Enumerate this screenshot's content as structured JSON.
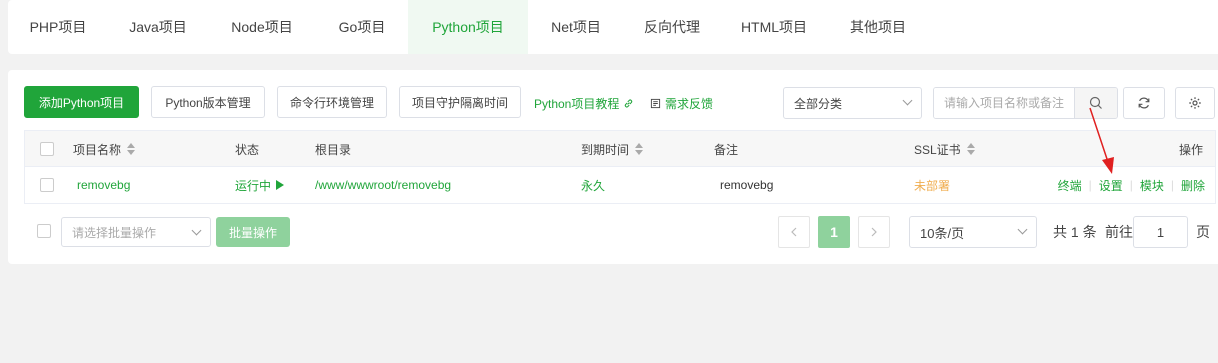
{
  "tabs": [
    {
      "label": "PHP项目",
      "active": false
    },
    {
      "label": "Java项目",
      "active": false
    },
    {
      "label": "Node项目",
      "active": false
    },
    {
      "label": "Go项目",
      "active": false
    },
    {
      "label": "Python项目",
      "active": true
    },
    {
      "label": "Net项目",
      "active": false
    },
    {
      "label": "反向代理",
      "active": false
    },
    {
      "label": "HTML项目",
      "active": false
    },
    {
      "label": "其他项目",
      "active": false
    }
  ],
  "toolbar": {
    "add_label": "添加Python项目",
    "version_label": "Python版本管理",
    "cmd_env_label": "命令行环境管理",
    "guard_label": "项目守护隔离时间",
    "tutorial_label": "Python项目教程",
    "feedback_label": "需求反馈",
    "category_value": "全部分类",
    "search_placeholder": "请输入项目名称或备注"
  },
  "table": {
    "headers": {
      "name": "项目名称",
      "status": "状态",
      "root": "根目录",
      "expire": "到期时间",
      "remark": "备注",
      "ssl": "SSL证书",
      "ops": "操作"
    },
    "rows": [
      {
        "name": "removebg",
        "status": "运行中",
        "root": "/www/wwwroot/removebg",
        "expire": "永久",
        "remark": "removebg",
        "ssl": "未部署",
        "ops": [
          "终端",
          "设置",
          "模块",
          "删除"
        ]
      }
    ]
  },
  "footer": {
    "batch_placeholder": "请选择批量操作",
    "batch_button": "批量操作",
    "current_page": "1",
    "page_size": "10条/页",
    "total_prefix": "共",
    "total_count": "1",
    "total_suffix": "条",
    "goto_label": "前往",
    "goto_value": "1",
    "page_suffix": "页"
  },
  "colors": {
    "accent": "#20a53a",
    "accent_light": "#8fd29d",
    "warning": "#f0ad4e",
    "annotation_arrow": "#e02020"
  }
}
